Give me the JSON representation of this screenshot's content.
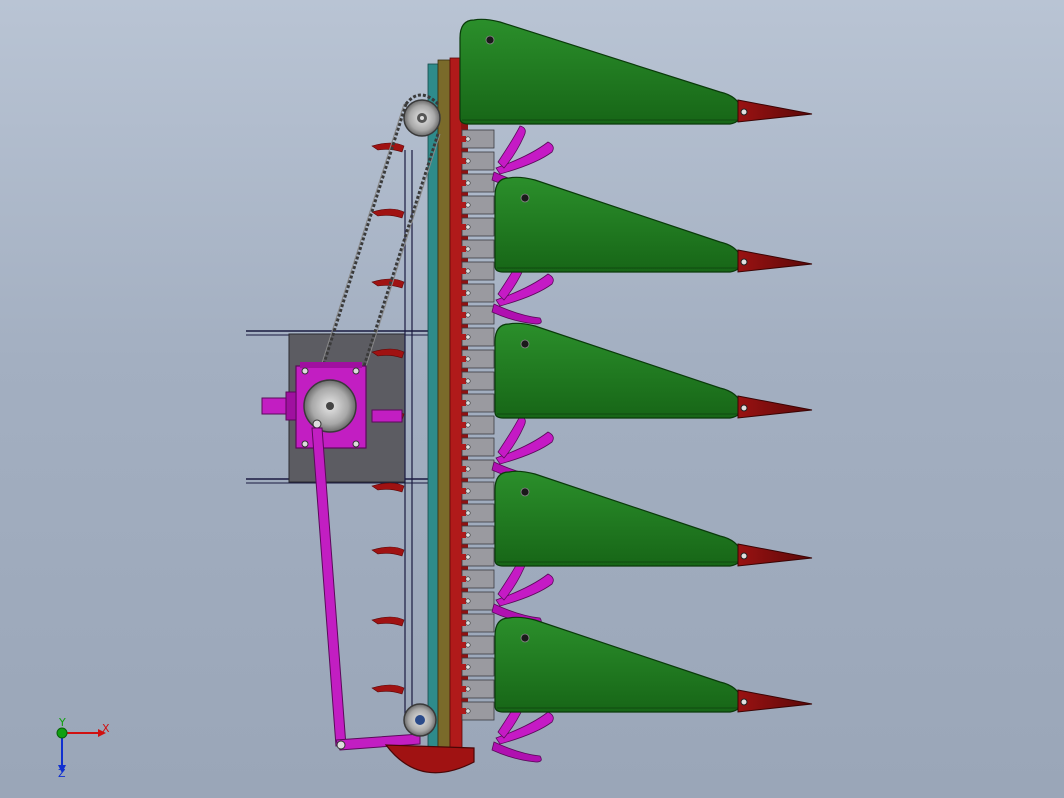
{
  "viewport": {
    "background_top": "#b9c4d4",
    "background_bottom": "#9aa6b8"
  },
  "colors": {
    "divider_green": "#1f7a1f",
    "divider_tip": "#8b0f0f",
    "gearbox_magenta": "#c21ec2",
    "finger_magenta": "#c51ac5",
    "frame_red": "#b01a1a",
    "teal_bar": "#2e8b8b",
    "olive_bar": "#7a6a2a",
    "mount_plate": "#5c5c62",
    "frame_line": "#1a1a40",
    "sprocket_grey": "#c0c0c0"
  },
  "model": {
    "crop_dividers": [
      "divider-1",
      "divider-2",
      "divider-3",
      "divider-4",
      "divider-5"
    ],
    "star_wheels": [
      "star-wheel-1",
      "star-wheel-2",
      "star-wheel-3",
      "star-wheel-4",
      "star-wheel-5"
    ],
    "icons": [
      "gearbox-icon",
      "sprocket-icon",
      "chain-icon",
      "crank-arm-icon",
      "input-shaft-icon"
    ]
  },
  "triad": {
    "x_label": "X",
    "y_label": "Y",
    "z_label": "Z",
    "x_color": "#d01010",
    "y_color": "#10a010",
    "z_color": "#1030d0"
  }
}
